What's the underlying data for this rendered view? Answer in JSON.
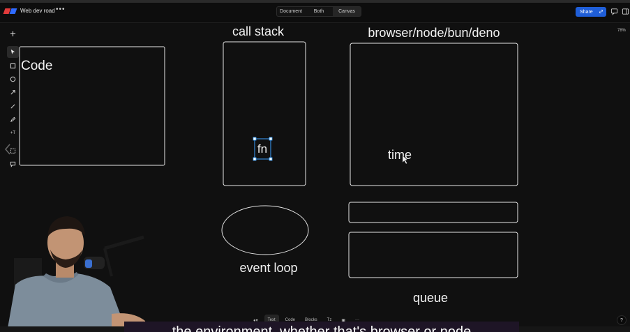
{
  "app": {
    "title": "Web dev road",
    "menu_icon": "more-dots-icon"
  },
  "view_modes": {
    "options": [
      "Document",
      "Both",
      "Canvas"
    ],
    "selected": "Canvas"
  },
  "header_actions": {
    "share_label": "Share",
    "icons": [
      "link-icon",
      "comment-icon",
      "sidebar-icon"
    ]
  },
  "zoom": "78%",
  "tools": [
    "plus-icon",
    "pointer-icon",
    "rectangle-icon",
    "circle-icon",
    "arrow-icon",
    "line-icon",
    "pencil-icon",
    "text-icon",
    "frame-icon",
    "comment-icon"
  ],
  "canvas": {
    "labels": {
      "code": "Code",
      "call_stack": "call stack",
      "runtime": "browser/node/bun/deno",
      "fn": "fn",
      "time": "time",
      "event_loop": "event loop",
      "queue": "queue"
    }
  },
  "bottom_toolbar": {
    "items": [
      "Text",
      "Code",
      "Blocks",
      "Tz"
    ],
    "active": "Text"
  },
  "help_label": "?",
  "caption": "the environment, whether that's browser or node",
  "colors": {
    "accent": "#1f5ed8",
    "selection": "#3aa0ff",
    "stroke": "#e6e6e6",
    "background": "#101010"
  }
}
